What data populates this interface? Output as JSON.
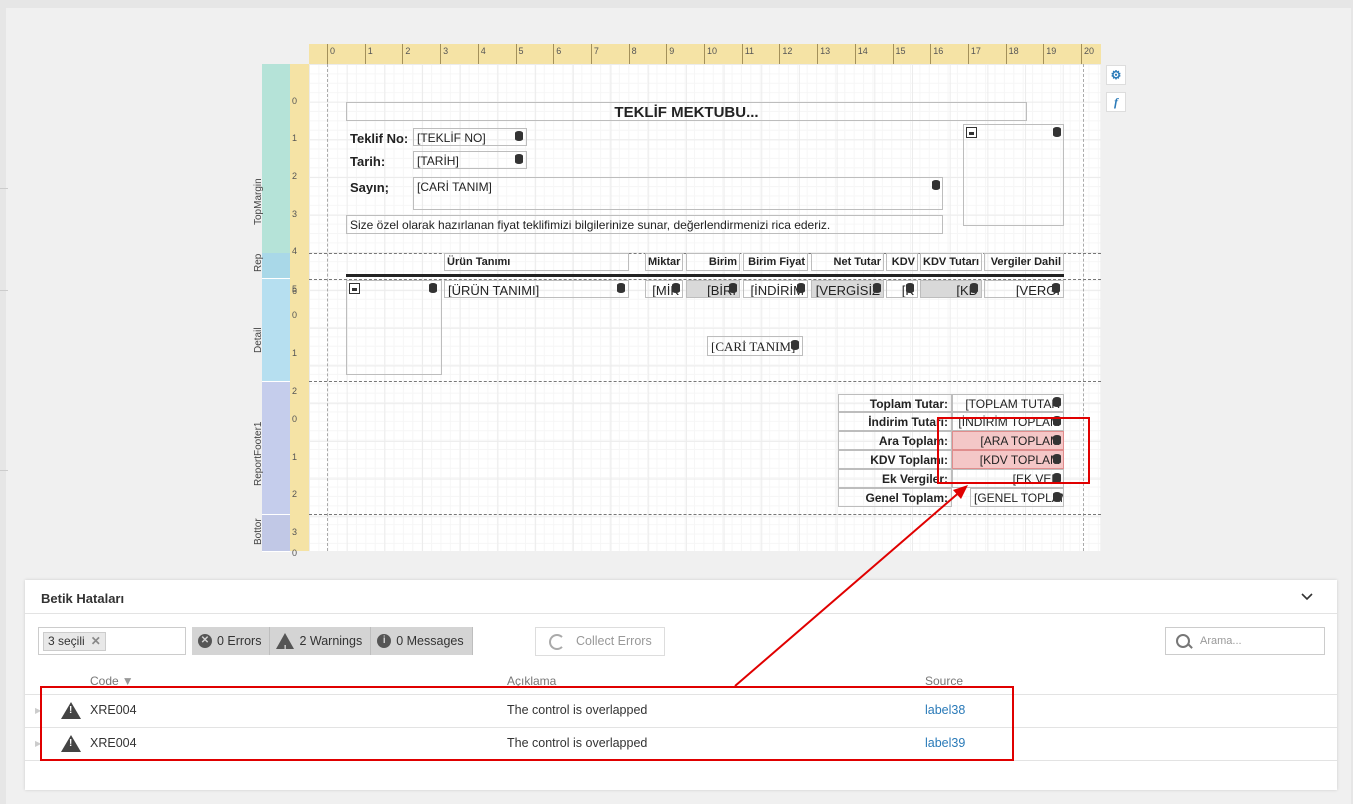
{
  "ruler": {
    "top": [
      "0",
      "1",
      "2",
      "3",
      "4",
      "5",
      "6",
      "7",
      "8",
      "9",
      "10",
      "11",
      "12",
      "13",
      "14",
      "15",
      "16",
      "17",
      "18",
      "19",
      "20"
    ],
    "left": [
      "0",
      "1",
      "2",
      "3",
      "4",
      "5",
      "6",
      "0",
      "1",
      "2",
      "0",
      "1",
      "2",
      "3",
      "0"
    ]
  },
  "bands": {
    "top_margin": "TopMargin",
    "report_header": "Rep",
    "detail": "Detail",
    "report_footer": "ReportFooter1",
    "bottom_margin": "Bottor"
  },
  "report": {
    "title": "TEKLİF MEKTUBU...",
    "teklif_no_label": "Teklif No:",
    "teklif_no_value": "[TEKLİF NO]",
    "tarih_label": "Tarih:",
    "tarih_value": "[TARİH]",
    "sayin_label": "Sayın;",
    "sayin_value": "[CARİ TANIM]",
    "intro": "Size özel olarak hazırlanan fiyat teklifimizi bilgilerinize sunar, değerlendirmenizi rica ederiz."
  },
  "table_header": {
    "urun": "Ürün Tanımı",
    "miktar": "Miktar",
    "birim": "Birim",
    "birim_fiyat": "Birim Fiyat",
    "net_tutar": "Net Tutar",
    "kdv": "KDV",
    "kdv_tutari": "KDV Tutarı",
    "vergiler": "Vergiler Dahil"
  },
  "detail_row": {
    "urun": "[ÜRÜN TANIMI]",
    "miktar": "[MİK",
    "birim": "[BİRİ",
    "indirim": "[İNDİRİM",
    "vergisiz": "[VERGİSİZ",
    "kdv": "[K",
    "kdv_tutari": "[KD",
    "vergili": "[VERGİ",
    "cari": "[CARİ TANIM]"
  },
  "footer": {
    "labels": [
      "Toplam Tutar:",
      "İndirim Tutarı:",
      "Ara Toplam:",
      "KDV Toplamı:",
      "Ek Vergiler:",
      "Genel Toplam:"
    ],
    "values": [
      "[TOPLAM TUTAR",
      "[İNDİRİM TOPLAM",
      "[ARA TOPLAM",
      "[KDV TOPLAM",
      "[EK VER",
      "[GENEL TOPLAM"
    ]
  },
  "side_buttons": {
    "settings": "⚙",
    "function": "f"
  },
  "panel": {
    "title": "Betik Hataları",
    "filter_tag": "3 seçili",
    "errors": "0 Errors",
    "warnings": "2 Warnings",
    "messages": "0 Messages",
    "collect": "Collect Errors",
    "search_placeholder": "Arama...",
    "columns": {
      "code": "Code",
      "description": "Açıklama",
      "source": "Source"
    },
    "rows": [
      {
        "code": "XRE004",
        "description": "The control is overlapped",
        "source": "label38"
      },
      {
        "code": "XRE004",
        "description": "The control is overlapped",
        "source": "label39"
      }
    ]
  },
  "colors": {
    "error_highlight": "#e00000",
    "link": "#2a7ab8",
    "ruler": "#f5e3a5"
  }
}
